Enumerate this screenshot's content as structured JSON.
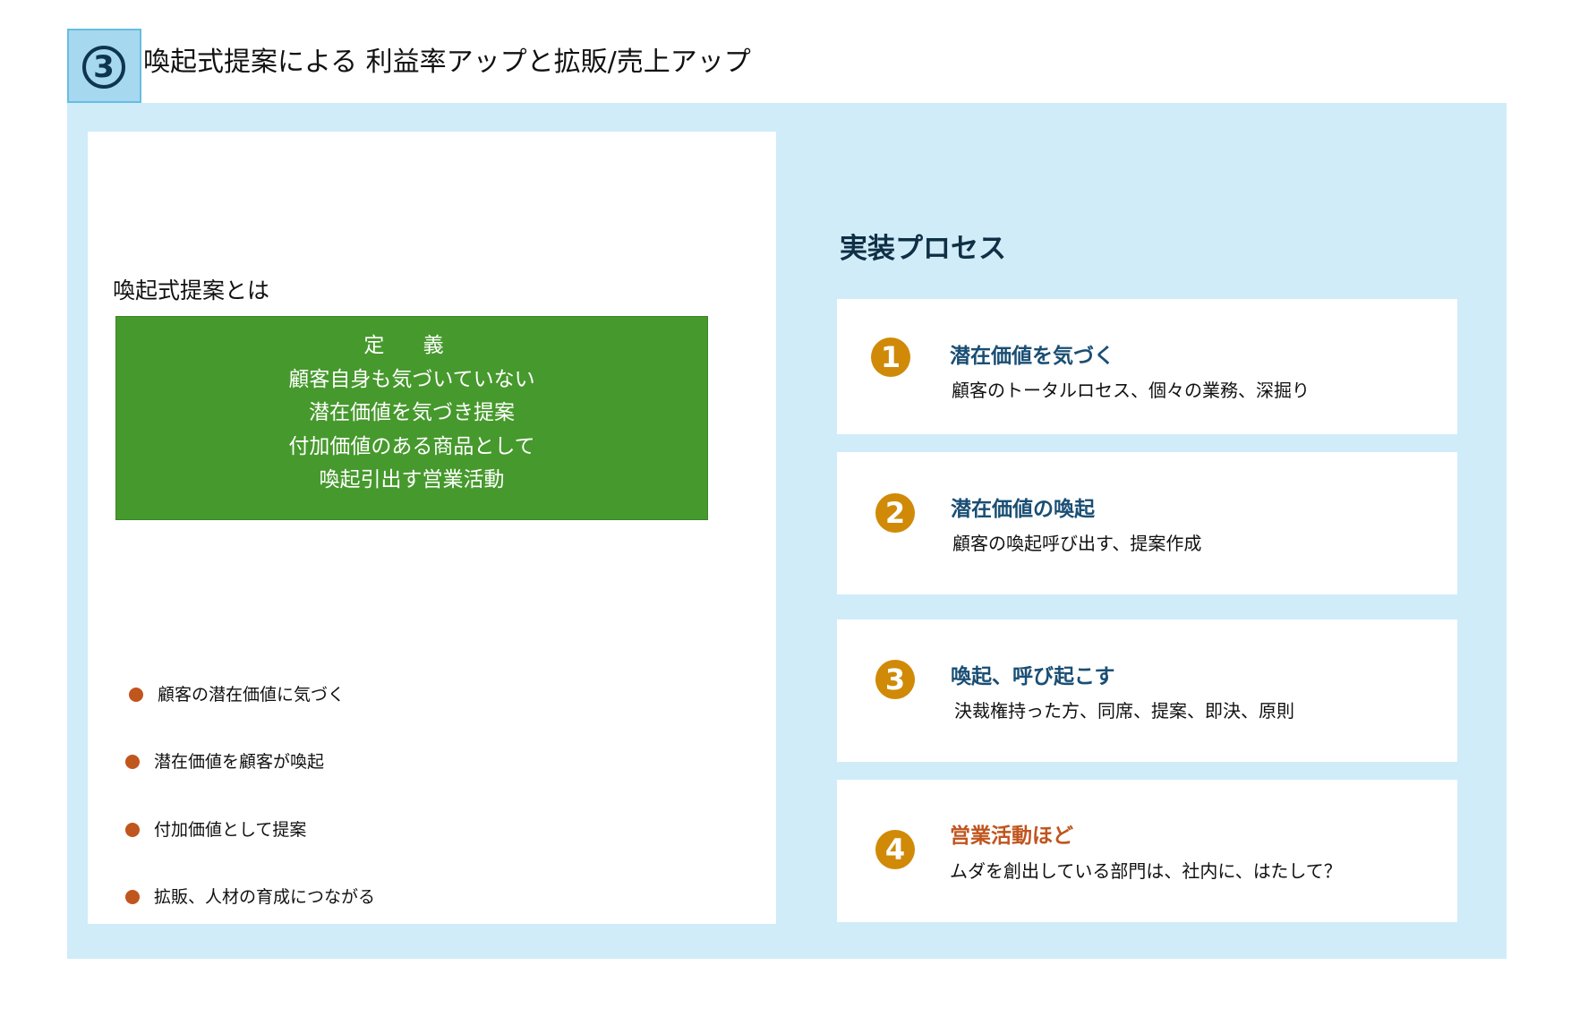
{
  "header": {
    "badge_number": "3",
    "title": "喚起式提案による 利益率アップと拡販/売上アップ"
  },
  "left": {
    "heading": "喚起式提案とは",
    "definition": {
      "label": "定 義",
      "lines": [
        "顧客自身も気づいていない",
        "潜在価値を気づき提案",
        "付加価値のある商品として",
        "喚起引出す営業活動"
      ]
    },
    "bullets": [
      "顧客の潜在価値に気づく",
      "潜在価値を顧客が喚起",
      "付加価値として提案",
      "拡販、人材の育成につながる"
    ]
  },
  "process": {
    "heading": "実装プロセス",
    "steps": [
      {
        "number": "1",
        "title": "潜在価値を気づく",
        "description": "顧客のトータルロセス、個々の業務、深掘り",
        "title_color": "#1a4e74",
        "circle_color": "#d08a07"
      },
      {
        "number": "2",
        "title": "潜在価値の喚起",
        "description": "顧客の喚起呼び出す、提案作成",
        "title_color": "#1a4e74",
        "circle_color": "#d08a07"
      },
      {
        "number": "3",
        "title": "喚起、呼び起こす",
        "description": "決裁権持った方、同席、提案、即決、原則",
        "title_color": "#1a4e74",
        "circle_color": "#d08a07"
      },
      {
        "number": "4",
        "title": "営業活動ほど",
        "description": "ムダを創出している部門は、社内に、はたして？",
        "title_color": "#c0551e",
        "circle_color": "#d08a07"
      }
    ]
  },
  "colors": {
    "panel_background": "#d0ecf9",
    "definition_green": "#46992c",
    "bullet_orange": "#c0551e",
    "badge_blue": "#a6d8ef"
  }
}
